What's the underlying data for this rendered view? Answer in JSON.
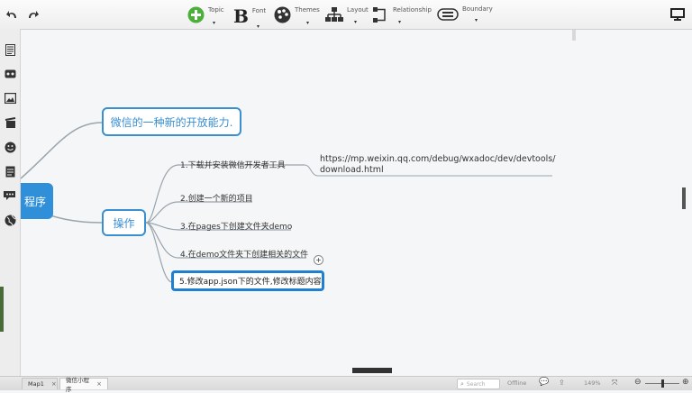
{
  "toolbar": {
    "topic_label": "Topic",
    "font_label": "Font",
    "themes_label": "Themes",
    "layout_label": "Layout",
    "relationship_label": "Relationship",
    "boundary_label": "Boundary"
  },
  "sidebar": {
    "icons": [
      "outline-icon",
      "tag-icon",
      "image-icon",
      "clip-icon",
      "smiley-icon",
      "notes-icon",
      "comments-icon",
      "globe-icon"
    ]
  },
  "mindmap": {
    "central_topic": "程序",
    "topic_1": "微信的一种新的开放能力.",
    "topic_2": "操作",
    "subtopics": [
      "1.下载并安装微信开发者工具",
      "2.创建一个新的项目",
      "3.在pages下创建文件夹demo",
      "4.在demo文件夹下创建相关的文件",
      "5.修改app.json下的文件,修改标题内容"
    ],
    "url_line1": "https://mp.weixin.qq.com/debug/wxadoc/dev/devtools/",
    "url_line2": "download.html",
    "collapse_symbol": "+"
  },
  "statusbar": {
    "tab1": "Map1",
    "tab2": "微信小程序",
    "tab_close": "×",
    "search_placeholder": "Search",
    "offline_label": "Offline",
    "zoom": "149%"
  },
  "colors": {
    "accent": "#3a8fd0",
    "central": "#2f8fd8"
  }
}
